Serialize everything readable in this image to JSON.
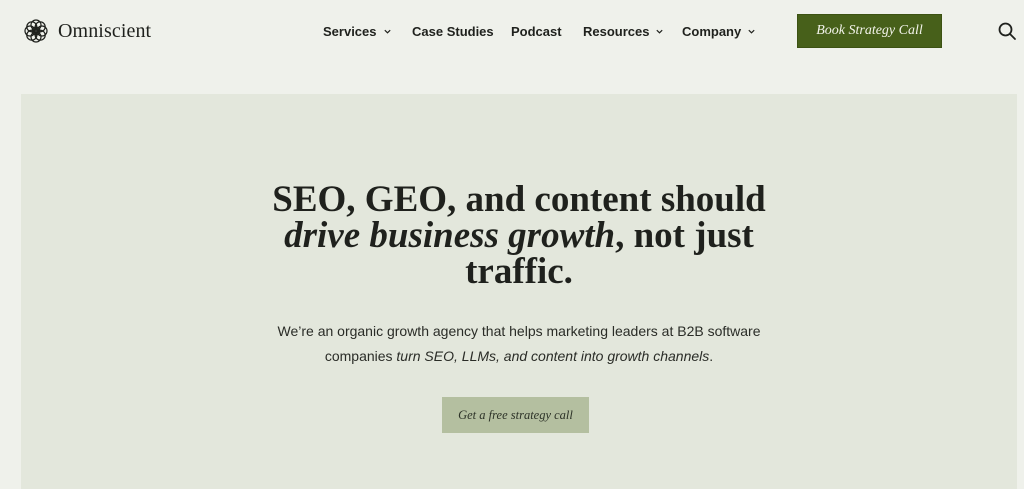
{
  "brand": {
    "name": "Omniscient"
  },
  "nav": {
    "items": [
      {
        "label": "Services",
        "has_dropdown": true
      },
      {
        "label": "Case Studies",
        "has_dropdown": false
      },
      {
        "label": "Podcast",
        "has_dropdown": false
      },
      {
        "label": "Resources",
        "has_dropdown": true
      },
      {
        "label": "Company",
        "has_dropdown": true
      }
    ],
    "cta_label": "Book Strategy Call",
    "search_icon": "search-icon"
  },
  "hero": {
    "headline_part1": "SEO, GEO, and content should",
    "headline_emphasis": "drive business growth",
    "headline_part2": ", not just",
    "headline_part3": "traffic.",
    "sub_part1": "We’re an organic growth agency that helps marketing leaders at B2B software",
    "sub_part2": "companies ",
    "sub_emphasis": "turn SEO, LLMs, and content into growth channels",
    "sub_part3": ".",
    "button_label": "Get a free strategy call"
  },
  "colors": {
    "page_bg": "#eff1eb",
    "hero_bg": "#e3e7dc",
    "cta_bg": "#47601a",
    "hero_button_bg": "#b4bfa0",
    "text": "#1f211d"
  }
}
